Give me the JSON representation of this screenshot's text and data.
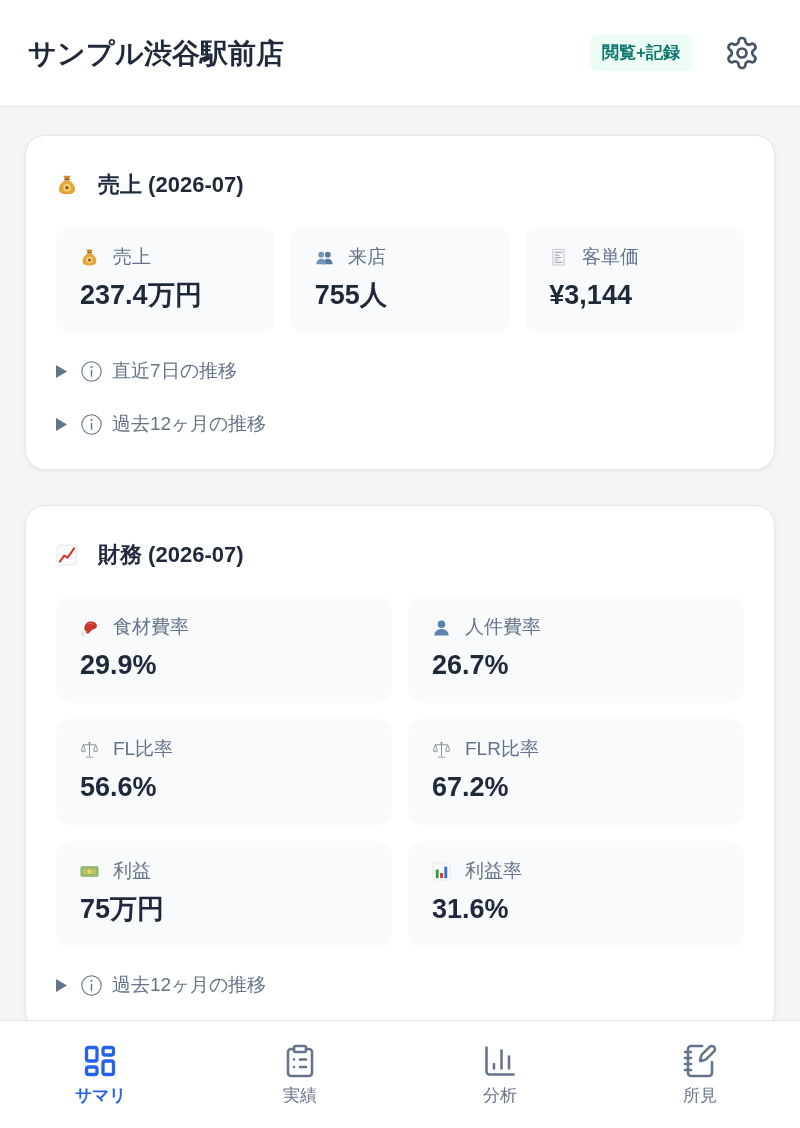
{
  "header": {
    "title": "サンプル渋谷駅前店",
    "badge": "閲覧+記録"
  },
  "sections": [
    {
      "title": "売上 (2026-07)",
      "metrics": [
        {
          "label": "売上",
          "value": "237.4万円"
        },
        {
          "label": "来店",
          "value": "755人"
        },
        {
          "label": "客単価",
          "value": "¥3,144"
        }
      ],
      "disclosures": [
        {
          "label": "直近7日の推移",
          "expanded": false
        },
        {
          "label": "過去12ヶ月の推移",
          "expanded": false
        }
      ]
    },
    {
      "title": "財務 (2026-07)",
      "metrics": [
        {
          "label": "食材費率",
          "value": "29.9%"
        },
        {
          "label": "人件費率",
          "value": "26.7%"
        },
        {
          "label": "FL比率",
          "value": "56.6%"
        },
        {
          "label": "FLR比率",
          "value": "67.2%"
        },
        {
          "label": "利益",
          "value": "75万円"
        },
        {
          "label": "利益率",
          "value": "31.6%"
        }
      ],
      "disclosures": [
        {
          "label": "過去12ヶ月の推移",
          "expanded": false
        }
      ]
    }
  ],
  "bottom_nav": [
    {
      "label": "サマリ",
      "selected": true
    },
    {
      "label": "実績",
      "selected": false
    },
    {
      "label": "分析",
      "selected": false
    },
    {
      "label": "所見",
      "selected": false
    }
  ]
}
